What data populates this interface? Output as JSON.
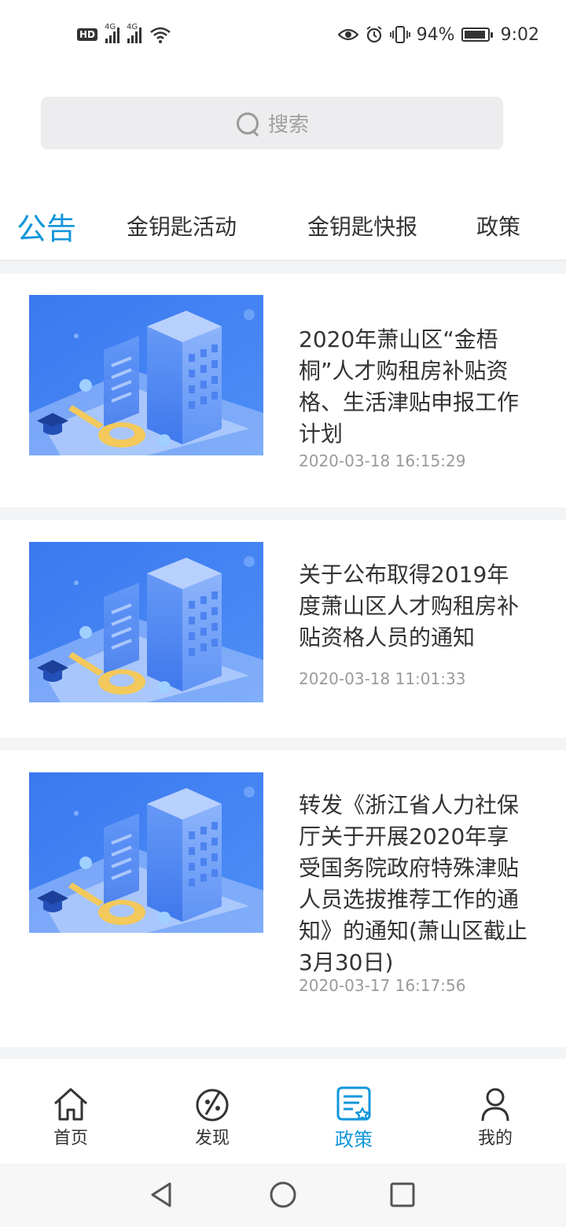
{
  "status_bar": {
    "hd": "HD",
    "net1": "4G",
    "net2": "4G",
    "battery_percent": "94%",
    "battery_level": 0.94,
    "time": "9:02"
  },
  "search": {
    "placeholder": "搜索"
  },
  "tabs": [
    {
      "label": "公告",
      "active": true
    },
    {
      "label": "金钥匙活动",
      "active": false
    },
    {
      "label": "金钥匙快报",
      "active": false
    },
    {
      "label": "政策",
      "active": false
    }
  ],
  "articles": [
    {
      "title": "2020年萧山区“金梧桐”人才购租房补贴资格、生活津贴申报工作计划",
      "date": "2020-03-18 16:15:29"
    },
    {
      "title": "关于公布取得2019年度萧山区人才购租房补贴资格人员的通知",
      "date": "2020-03-18 11:01:33"
    },
    {
      "title": "转发《浙江省人力社保厅关于开展2020年享受国务院政府特殊津贴人员选拔推荐工作的通知》的通知(萧山区截止3月30日)",
      "date": "2020-03-17 16:17:56"
    }
  ],
  "bottom_nav": [
    {
      "label": "首页",
      "icon": "home-icon",
      "active": false
    },
    {
      "label": "发现",
      "icon": "discover-icon",
      "active": false
    },
    {
      "label": "政策",
      "icon": "policy-icon",
      "active": true
    },
    {
      "label": "我的",
      "icon": "profile-icon",
      "active": false
    }
  ],
  "colors": {
    "accent": "#1296db",
    "text": "#333333",
    "muted": "#9a9a9a",
    "feed_bg": "#f3f4f6"
  }
}
